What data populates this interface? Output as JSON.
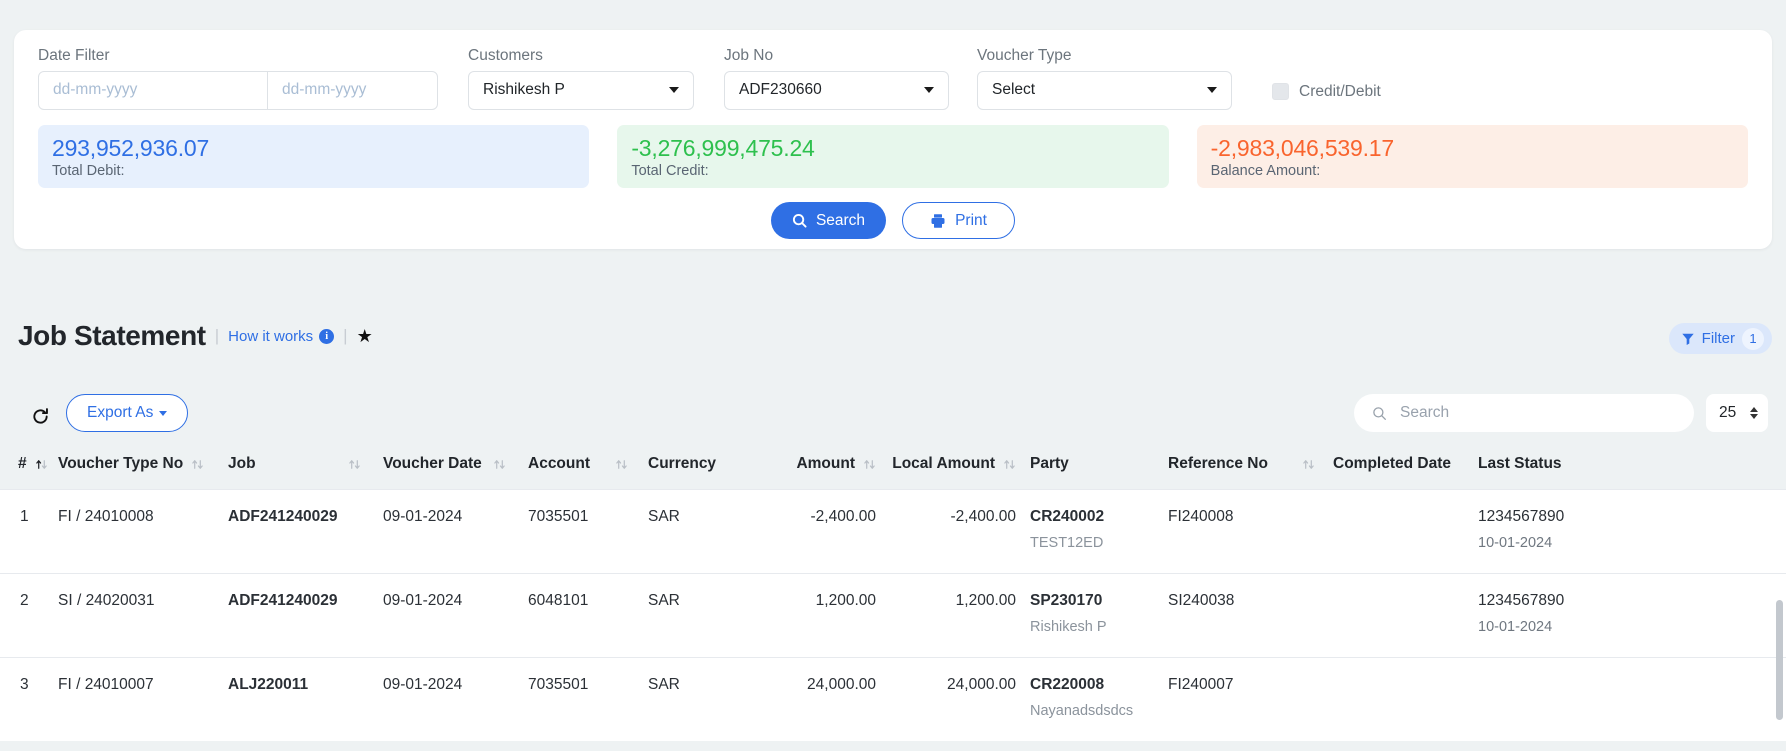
{
  "filters": {
    "date": {
      "label": "Date Filter",
      "from_placeholder": "dd-mm-yyyy",
      "from_value": "",
      "to_placeholder": "dd-mm-yyyy",
      "to_value": ""
    },
    "customers": {
      "label": "Customers",
      "value": "Rishikesh P"
    },
    "job_no": {
      "label": "Job No",
      "value": "ADF230660"
    },
    "voucher_type": {
      "label": "Voucher Type",
      "value": "Select"
    },
    "credit_debit": {
      "label": "Credit/Debit",
      "checked": false
    }
  },
  "summary": {
    "debit": {
      "value": "293,952,936.07",
      "label": "Total Debit:",
      "color": "#2f6fe4"
    },
    "credit": {
      "value": "-3,276,999,475.24",
      "label": "Total Credit:",
      "color": "#2ec04e"
    },
    "balance": {
      "value": "-2,983,046,539.17",
      "label": "Balance Amount:",
      "color": "#f9642e"
    }
  },
  "actions": {
    "search_label": "Search",
    "print_label": "Print"
  },
  "header": {
    "title": "Job Statement",
    "how_it_works": "How it works",
    "info_glyph": "i",
    "star_glyph": "★",
    "filter_label": "Filter",
    "filter_count": "1"
  },
  "toolbar": {
    "export_label": "Export As",
    "search_placeholder": "Search",
    "search_value": "",
    "page_size": "25"
  },
  "table": {
    "columns": [
      {
        "label": "#",
        "sortable": true,
        "active": true,
        "align": "left"
      },
      {
        "label": "Voucher Type No",
        "sortable": true,
        "active": false,
        "align": "left"
      },
      {
        "label": "Job",
        "sortable": true,
        "active": false,
        "align": "left"
      },
      {
        "label": "Voucher Date",
        "sortable": true,
        "active": false,
        "align": "left"
      },
      {
        "label": "Account",
        "sortable": true,
        "active": false,
        "align": "left"
      },
      {
        "label": "Currency",
        "sortable": false,
        "active": false,
        "align": "left"
      },
      {
        "label": "Amount",
        "sortable": true,
        "active": false,
        "align": "right"
      },
      {
        "label": "Local Amount",
        "sortable": true,
        "active": false,
        "align": "right"
      },
      {
        "label": "Party",
        "sortable": false,
        "active": false,
        "align": "left"
      },
      {
        "label": "Reference No",
        "sortable": true,
        "active": false,
        "align": "left"
      },
      {
        "label": "Completed Date",
        "sortable": false,
        "active": false,
        "align": "left"
      },
      {
        "label": "Last Status",
        "sortable": false,
        "active": false,
        "align": "left"
      }
    ],
    "rows": [
      {
        "index": "1",
        "voucher_type_no": "FI / 24010008",
        "job": "ADF241240029",
        "voucher_date": "09-01-2024",
        "account": "7035501",
        "currency": "SAR",
        "amount": "-2,400.00",
        "local_amount": "-2,400.00",
        "party": "CR240002",
        "party_sub": "TEST12ED",
        "reference_no": "FI240008",
        "completed_date": "",
        "last_status": "1234567890",
        "last_status_sub": "10-01-2024"
      },
      {
        "index": "2",
        "voucher_type_no": "SI / 24020031",
        "job": "ADF241240029",
        "voucher_date": "09-01-2024",
        "account": "6048101",
        "currency": "SAR",
        "amount": "1,200.00",
        "local_amount": "1,200.00",
        "party": "SP230170",
        "party_sub": "Rishikesh P",
        "reference_no": "SI240038",
        "completed_date": "",
        "last_status": "1234567890",
        "last_status_sub": "10-01-2024"
      },
      {
        "index": "3",
        "voucher_type_no": "FI / 24010007",
        "job": "ALJ220011",
        "voucher_date": "09-01-2024",
        "account": "7035501",
        "currency": "SAR",
        "amount": "24,000.00",
        "local_amount": "24,000.00",
        "party": "CR220008",
        "party_sub": "Nayanadsdsdcs",
        "reference_no": "FI240007",
        "completed_date": "",
        "last_status": "",
        "last_status_sub": ""
      }
    ]
  }
}
